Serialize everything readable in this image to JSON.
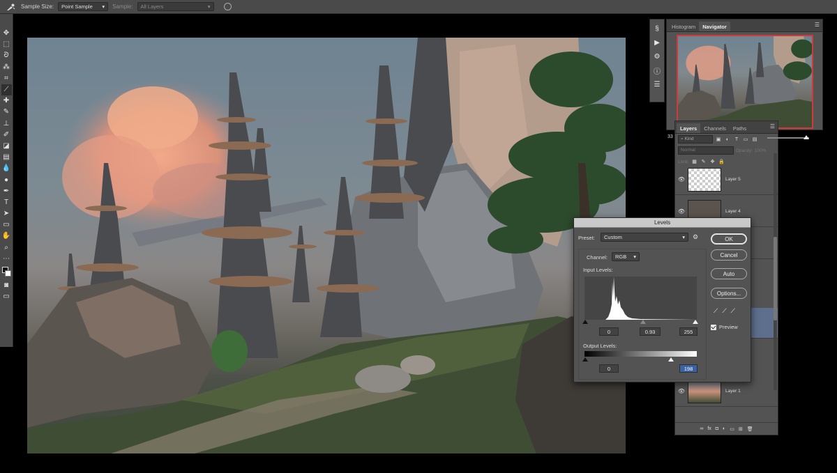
{
  "options_bar": {
    "tool_icon": "eyedropper-icon",
    "sample_size_label": "Sample Size:",
    "sample_size_value": "Point Sample",
    "sample_label": "Sample:",
    "sample_value": "All Layers"
  },
  "tools": [
    "move",
    "marquee",
    "lasso",
    "magic-wand",
    "crop",
    "eyedropper",
    "healing",
    "brush",
    "clone",
    "history-brush",
    "eraser",
    "gradient",
    "blur",
    "dodge",
    "pen",
    "type",
    "path-select",
    "rectangle",
    "hand",
    "zoom",
    "more"
  ],
  "panels": {
    "nav_tabs": [
      "Histogram",
      "Navigator"
    ],
    "nav_active": "Navigator",
    "nav_zoom": "33",
    "layers_tabs": [
      "Layers",
      "Channels",
      "Paths"
    ],
    "layers_active": "Layers",
    "filter_kind": "Kind",
    "blend_mode": "Normal",
    "opacity_label": "Opacity:",
    "opacity_value": "100%",
    "lock_label": "Lock:",
    "layers": [
      {
        "name": "Layer 5",
        "visible": true,
        "selected": false
      },
      {
        "name": "Layer 4",
        "visible": true,
        "selected": false
      },
      {
        "name": "",
        "visible": false,
        "selected": false
      },
      {
        "name": "",
        "visible": false,
        "selected": true
      },
      {
        "name": "",
        "visible": false,
        "selected": false
      },
      {
        "name": "Layer 1",
        "visible": true,
        "selected": false
      }
    ]
  },
  "levels": {
    "title": "Levels",
    "preset_label": "Preset:",
    "preset_value": "Custom",
    "channel_label": "Channel:",
    "channel_value": "RGB",
    "input_label": "Input Levels:",
    "input_black": "0",
    "input_gamma": "0.93",
    "input_white": "255",
    "output_label": "Output Levels:",
    "output_black": "0",
    "output_white": "198",
    "buttons": {
      "ok": "OK",
      "cancel": "Cancel",
      "auto": "Auto",
      "options": "Options..."
    },
    "preview_label": "Preview",
    "preview_checked": true
  }
}
